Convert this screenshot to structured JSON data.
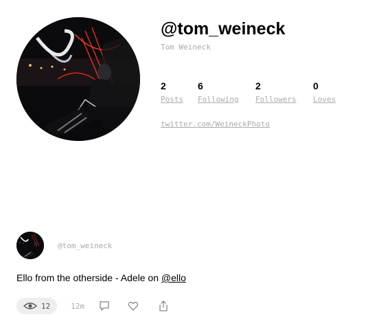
{
  "profile": {
    "username": "@tom_weineck",
    "name": "Tom Weineck",
    "stats": [
      {
        "key": "posts",
        "count": "2",
        "label": "Posts"
      },
      {
        "key": "following",
        "count": "6",
        "label": "Following"
      },
      {
        "key": "followers",
        "count": "2",
        "label": "Followers"
      },
      {
        "key": "loves",
        "count": "0",
        "label": "Loves"
      }
    ],
    "link": "twitter.com/WeineckPhoto",
    "avatar_icon": "avatar-photo-night-light-painting"
  },
  "post": {
    "author": "@tom_weineck",
    "body_text": "Ello from the otherside - Adele on ",
    "mention": "@ello",
    "views": "12",
    "timestamp": "12m",
    "icons": {
      "views": "eye-icon",
      "comment": "comment-icon",
      "love": "heart-icon",
      "share": "share-icon"
    }
  },
  "colors": {
    "text": "#000000",
    "muted": "#aaaaaa",
    "pill": "#eeeeee"
  }
}
